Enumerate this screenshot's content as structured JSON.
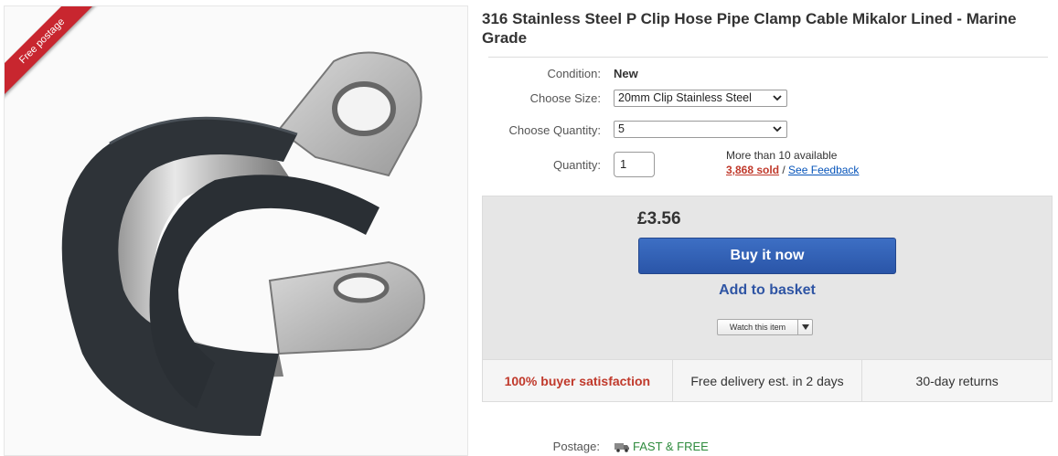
{
  "product": {
    "title": "316 Stainless Steel P Clip Hose Pipe Clamp Cable Mikalor Lined - Marine Grade",
    "ribbon": "Free postage"
  },
  "details": {
    "condition_label": "Condition:",
    "condition_value": "New",
    "size_label": "Choose Size:",
    "size_value": "20mm Clip Stainless Steel",
    "choose_qty_label": "Choose Quantity:",
    "choose_qty_value": "5",
    "quantity_label": "Quantity:",
    "quantity_value": "1",
    "availability": "More than 10 available",
    "sold": "3,868 sold",
    "sold_separator": " / ",
    "feedback": "See Feedback"
  },
  "buy": {
    "price": "£3.56",
    "buy_now": "Buy it now",
    "add_to_basket": "Add to basket",
    "watch": "Watch this item"
  },
  "stats": {
    "satisfaction": "100% buyer satisfaction",
    "delivery": "Free delivery est. in 2 days",
    "returns": "30-day returns"
  },
  "postage": {
    "label": "Postage:",
    "value": "FAST & FREE"
  },
  "colors": {
    "ribbon": "#c8262f",
    "buy_button": "#2f5cb5",
    "link": "#0654ba",
    "sold": "#c0392b",
    "free_postage": "#2e8b3d"
  }
}
